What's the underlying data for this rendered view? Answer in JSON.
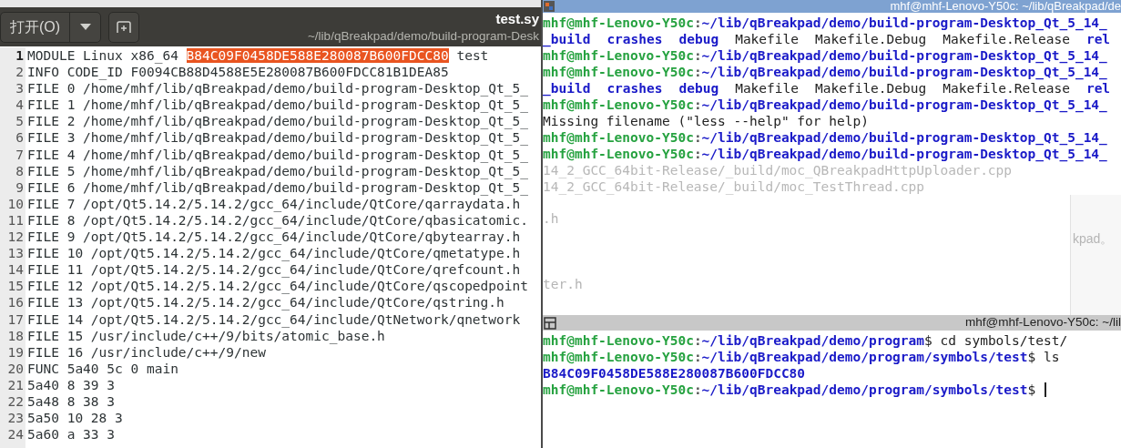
{
  "editor": {
    "open_button": "打开(O)",
    "title": "test.sy",
    "subtitle": "~/lib/qBreakpad/demo/build-program-Desk",
    "lines": [
      {
        "number": "1",
        "current": true,
        "parts": [
          {
            "text": "MODULE Linux x86_64 ",
            "kind": "plain"
          },
          {
            "text": "B84C09F0458DE588E280087B600FDCC80",
            "kind": "highlight"
          },
          {
            "text": " test",
            "kind": "plain"
          }
        ]
      },
      {
        "number": "2",
        "current": false,
        "text": "INFO CODE_ID F0094CB88D4588E5E280087B600FDCC81B1DEA85"
      },
      {
        "number": "3",
        "current": false,
        "text": "FILE 0 /home/mhf/lib/qBreakpad/demo/build-program-Desktop_Qt_5_"
      },
      {
        "number": "4",
        "current": false,
        "text": "FILE 1 /home/mhf/lib/qBreakpad/demo/build-program-Desktop_Qt_5_"
      },
      {
        "number": "5",
        "current": false,
        "text": "FILE 2 /home/mhf/lib/qBreakpad/demo/build-program-Desktop_Qt_5_"
      },
      {
        "number": "6",
        "current": false,
        "text": "FILE 3 /home/mhf/lib/qBreakpad/demo/build-program-Desktop_Qt_5_"
      },
      {
        "number": "7",
        "current": false,
        "text": "FILE 4 /home/mhf/lib/qBreakpad/demo/build-program-Desktop_Qt_5_"
      },
      {
        "number": "8",
        "current": false,
        "text": "FILE 5 /home/mhf/lib/qBreakpad/demo/build-program-Desktop_Qt_5_"
      },
      {
        "number": "9",
        "current": false,
        "text": "FILE 6 /home/mhf/lib/qBreakpad/demo/build-program-Desktop_Qt_5_"
      },
      {
        "number": "10",
        "current": false,
        "text": "FILE 7 /opt/Qt5.14.2/5.14.2/gcc_64/include/QtCore/qarraydata.h"
      },
      {
        "number": "11",
        "current": false,
        "text": "FILE 8 /opt/Qt5.14.2/5.14.2/gcc_64/include/QtCore/qbasicatomic."
      },
      {
        "number": "12",
        "current": false,
        "text": "FILE 9 /opt/Qt5.14.2/5.14.2/gcc_64/include/QtCore/qbytearray.h"
      },
      {
        "number": "13",
        "current": false,
        "text": "FILE 10 /opt/Qt5.14.2/5.14.2/gcc_64/include/QtCore/qmetatype.h"
      },
      {
        "number": "14",
        "current": false,
        "text": "FILE 11 /opt/Qt5.14.2/5.14.2/gcc_64/include/QtCore/qrefcount.h"
      },
      {
        "number": "15",
        "current": false,
        "text": "FILE 12 /opt/Qt5.14.2/5.14.2/gcc_64/include/QtCore/qscopedpoint"
      },
      {
        "number": "16",
        "current": false,
        "text": "FILE 13 /opt/Qt5.14.2/5.14.2/gcc_64/include/QtCore/qstring.h"
      },
      {
        "number": "17",
        "current": false,
        "text": "FILE 14 /opt/Qt5.14.2/5.14.2/gcc_64/include/QtNetwork/qnetwork"
      },
      {
        "number": "18",
        "current": false,
        "text": "FILE 15 /usr/include/c++/9/bits/atomic_base.h"
      },
      {
        "number": "19",
        "current": false,
        "text": "FILE 16 /usr/include/c++/9/new"
      },
      {
        "number": "20",
        "current": false,
        "text": "FUNC 5a40 5c 0 main"
      },
      {
        "number": "21",
        "current": false,
        "text": "5a40 8 39 3"
      },
      {
        "number": "22",
        "current": false,
        "text": "5a48 8 38 3"
      },
      {
        "number": "23",
        "current": false,
        "text": "5a50 10 28 3"
      },
      {
        "number": "24",
        "current": false,
        "text": "5a60 a 33 3"
      }
    ]
  },
  "terminal_top": {
    "title": "mhf@mhf-Lenovo-Y50c: ~/lib/qBreakpad/de",
    "lines": [
      [
        {
          "text": "mhf@mhf-Lenovo-Y50c",
          "kind": "user"
        },
        {
          "text": ":",
          "kind": "sep"
        },
        {
          "text": "~/lib/qBreakpad/demo/build-program-Desktop_Qt_5_14_",
          "kind": "path"
        }
      ],
      [
        {
          "text": "_build",
          "kind": "dir"
        },
        {
          "text": "crashes",
          "kind": "dir"
        },
        {
          "text": "debug",
          "kind": "dir"
        },
        {
          "text": "Makefile",
          "kind": "plain"
        },
        {
          "text": "Makefile.Debug",
          "kind": "plain"
        },
        {
          "text": "Makefile.Release",
          "kind": "plain"
        },
        {
          "text": "rel",
          "kind": "dir"
        }
      ],
      [
        {
          "text": "mhf@mhf-Lenovo-Y50c",
          "kind": "user"
        },
        {
          "text": ":",
          "kind": "sep"
        },
        {
          "text": "~/lib/qBreakpad/demo/build-program-Desktop_Qt_5_14_",
          "kind": "path"
        }
      ],
      [
        {
          "text": "mhf@mhf-Lenovo-Y50c",
          "kind": "user"
        },
        {
          "text": ":",
          "kind": "sep"
        },
        {
          "text": "~/lib/qBreakpad/demo/build-program-Desktop_Qt_5_14_",
          "kind": "path"
        }
      ],
      [
        {
          "text": "_build",
          "kind": "dir"
        },
        {
          "text": "crashes",
          "kind": "dir"
        },
        {
          "text": "debug",
          "kind": "dir"
        },
        {
          "text": "Makefile",
          "kind": "plain"
        },
        {
          "text": "Makefile.Debug",
          "kind": "plain"
        },
        {
          "text": "Makefile.Release",
          "kind": "plain"
        },
        {
          "text": "rel",
          "kind": "dir"
        }
      ],
      [
        {
          "text": "mhf@mhf-Lenovo-Y50c",
          "kind": "user"
        },
        {
          "text": ":",
          "kind": "sep"
        },
        {
          "text": "~/lib/qBreakpad/demo/build-program-Desktop_Qt_5_14_",
          "kind": "path"
        }
      ],
      [
        {
          "text": "Missing filename (\"less --help\" for help)",
          "kind": "plain"
        }
      ],
      [
        {
          "text": "mhf@mhf-Lenovo-Y50c",
          "kind": "user"
        },
        {
          "text": ":",
          "kind": "sep"
        },
        {
          "text": "~/lib/qBreakpad/demo/build-program-Desktop_Qt_5_14_",
          "kind": "path"
        }
      ],
      [
        {
          "text": "mhf@mhf-Lenovo-Y50c",
          "kind": "user"
        },
        {
          "text": ":",
          "kind": "sep"
        },
        {
          "text": "~/lib/qBreakpad/demo/build-program-Desktop_Qt_5_14_",
          "kind": "path"
        }
      ],
      [
        {
          "text": "14_2_GCC_64bit-Release/_build/moc_QBreakpadHttpUploader.cpp",
          "kind": "ghost"
        }
      ],
      [
        {
          "text": "14_2_GCC_64bit-Release/_build/moc_TestThread.cpp",
          "kind": "ghost"
        }
      ]
    ]
  },
  "background_fragments": [
    ".h",
    "ter.h"
  ],
  "side_fragment": "kpad。",
  "terminal_bottom": {
    "title": "mhf@mhf-Lenovo-Y50c: ~/lil",
    "lines": [
      [
        {
          "text": "mhf@mhf-Lenovo-Y50c",
          "kind": "user"
        },
        {
          "text": ":",
          "kind": "sep"
        },
        {
          "text": "~/lib/qBreakpad/demo/program",
          "kind": "path"
        },
        {
          "text": "$ cd symbols/test/",
          "kind": "plain"
        }
      ],
      [
        {
          "text": "mhf@mhf-Lenovo-Y50c",
          "kind": "user"
        },
        {
          "text": ":",
          "kind": "sep"
        },
        {
          "text": "~/lib/qBreakpad/demo/program/symbols/test",
          "kind": "path"
        },
        {
          "text": "$ ls",
          "kind": "plain"
        }
      ],
      [
        {
          "text": "B84C09F0458DE588E280087B600FDCC80",
          "kind": "dir"
        }
      ],
      [
        {
          "text": "mhf@mhf-Lenovo-Y50c",
          "kind": "user"
        },
        {
          "text": ":",
          "kind": "sep"
        },
        {
          "text": "~/lib/qBreakpad/demo/program/symbols/test",
          "kind": "path"
        },
        {
          "text": "$",
          "kind": "plain"
        }
      ]
    ],
    "cursor": true
  }
}
